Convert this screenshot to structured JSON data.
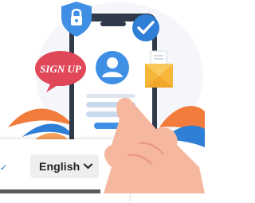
{
  "illustration": {
    "signup_text": "SIGN UP",
    "icons": [
      "lock-icon",
      "check-badge-icon",
      "user-icon",
      "envelope-icon"
    ]
  },
  "language_selector": {
    "selected_label": "English",
    "icon": "chevron-down-icon"
  },
  "colors": {
    "brand_blue": "#2f7fd6",
    "signup_red": "#e0485a",
    "envelope_yellow": "#f5b63a",
    "leaf_orange": "#f27c3c",
    "skin": "#f6b79f"
  }
}
